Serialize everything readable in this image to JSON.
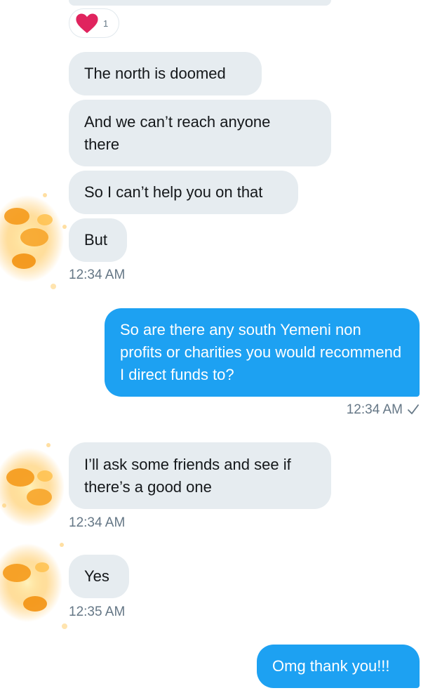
{
  "reaction": {
    "emoji_icon": "heart-icon",
    "count": "1",
    "color": "#e0245e"
  },
  "colors": {
    "incoming_bubble": "#e6ecf0",
    "outgoing_bubble": "#1da1f2",
    "timestamp": "#657786"
  },
  "messages": [
    {
      "direction": "in",
      "text": "The north is doomed"
    },
    {
      "direction": "in",
      "text": "And we can’t reach anyone there"
    },
    {
      "direction": "in",
      "text": "So I can’t help you on that"
    },
    {
      "direction": "in",
      "text": "But",
      "timestamp": "12:34 AM"
    },
    {
      "direction": "out",
      "text": "So are there any south Yemeni non profits or charities you would recommend I direct funds to?",
      "timestamp": "12:34 AM",
      "status_icon": "checkmark-icon"
    },
    {
      "direction": "in",
      "text": "I’ll ask some friends and see if there’s a good one",
      "timestamp": "12:34 AM"
    },
    {
      "direction": "in",
      "text": "Yes",
      "timestamp": "12:35 AM"
    },
    {
      "direction": "out",
      "text": "Omg thank you!!!"
    }
  ]
}
